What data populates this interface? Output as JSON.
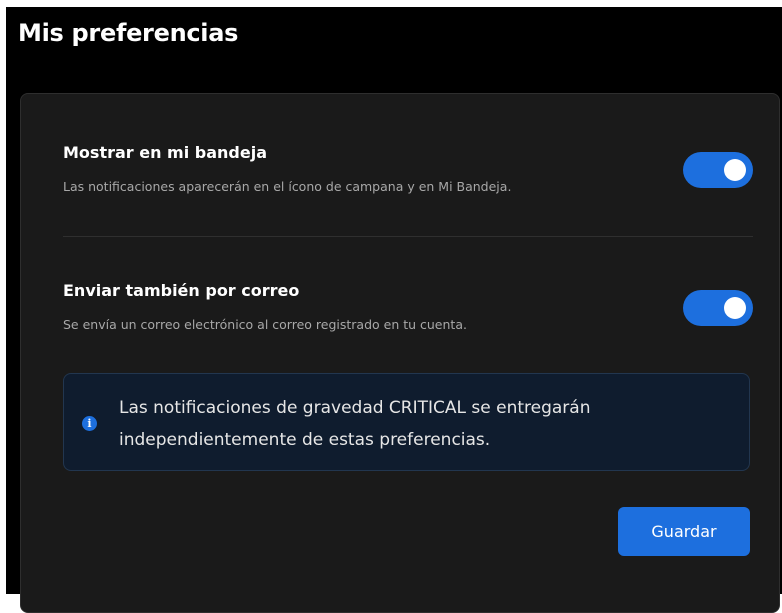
{
  "page": {
    "title": "Mis preferencias"
  },
  "preferences": [
    {
      "title": "Mostrar en mi bandeja",
      "description": "Las notificaciones aparecerán en el ícono de campana y en Mi Bandeja.",
      "enabled": true
    },
    {
      "title": "Enviar también por correo",
      "description": "Se envía un correo electrónico al correo registrado en tu cuenta.",
      "enabled": true
    }
  ],
  "info": {
    "icon": "info-circle-icon",
    "text": "Las notificaciones de gravedad CRITICAL se entregarán independientemente de estas preferencias."
  },
  "actions": {
    "save_label": "Guardar"
  },
  "colors": {
    "accent": "#1d6fde",
    "background": "#000000",
    "card": "#1a1a1a",
    "info_background": "#0f1c2e"
  }
}
